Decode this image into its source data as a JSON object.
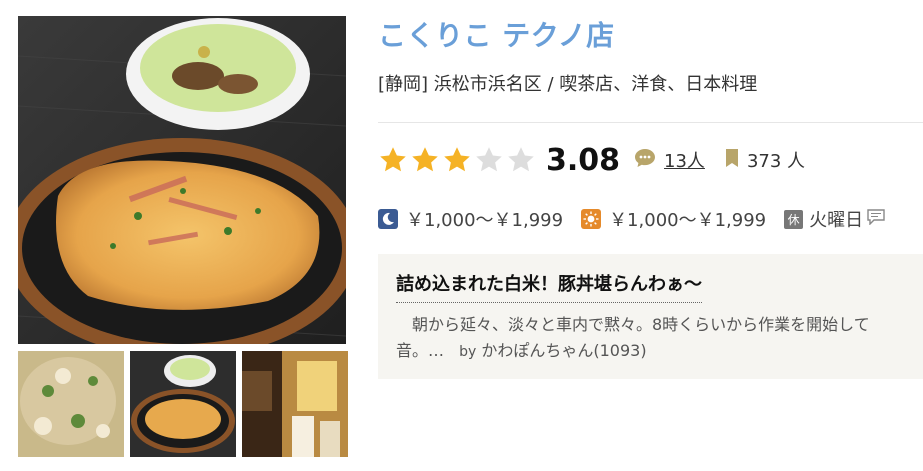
{
  "restaurant": {
    "name": "こくりこ テクノ店",
    "area": "[静岡] 浜松市浜名区 / 喫茶店、洋食、日本料理"
  },
  "rating": {
    "stars": 3.08,
    "score": "3.08",
    "review_count": "13人",
    "save_count": "373 人"
  },
  "prices": {
    "dinner": "￥1,000～￥1,999",
    "lunch": "￥1,000～￥1,999",
    "holiday_badge": "休",
    "holiday": "火曜日"
  },
  "review": {
    "title": "詰め込まれた白米！豚丼堪らんわぁ～",
    "line1": "朝から延々、淡々と車内で黙々。8時くらいから作業を開始して",
    "line2": "音。…",
    "by_label": "by",
    "author": "かわぽんちゃん(1093)"
  },
  "colors": {
    "title": "#6a9fd8",
    "star_on": "#f5b225",
    "star_off": "#dddddd",
    "dinner_icon_bg": "#3b5b93",
    "lunch_icon_bg": "#e58a2b"
  },
  "icons": {
    "review": "speech-bubble-icon",
    "save": "bookmark-icon",
    "dinner": "moon-icon",
    "lunch": "sun-icon",
    "holiday_comment": "comment-icon"
  }
}
